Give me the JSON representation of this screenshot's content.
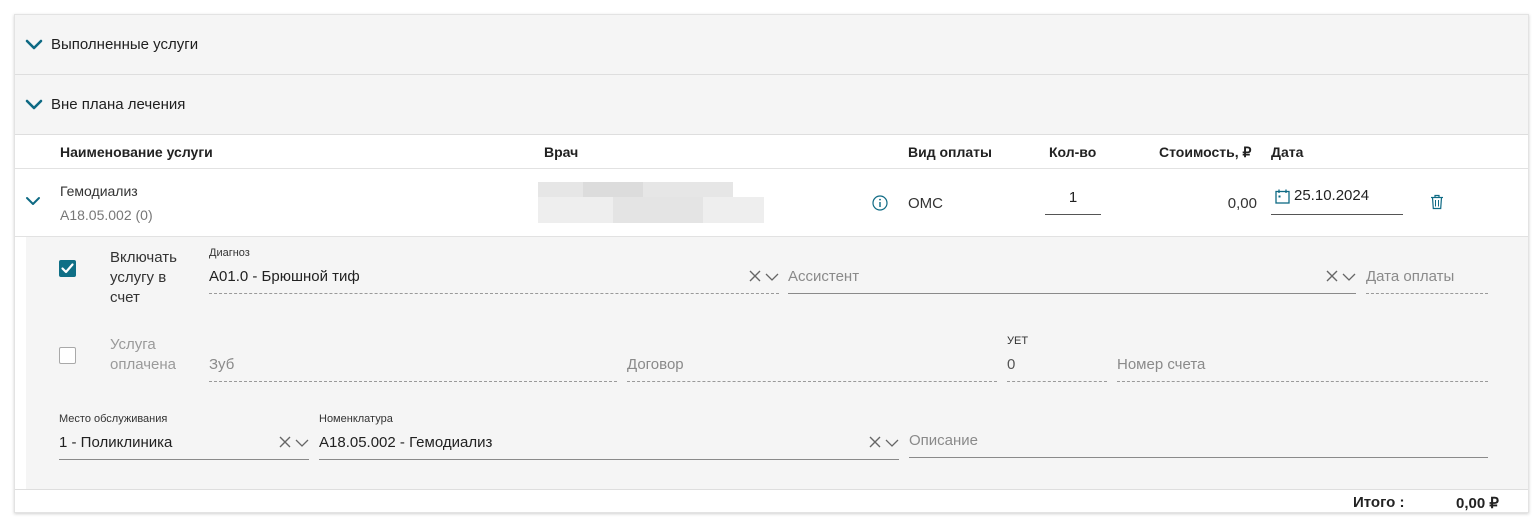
{
  "sections": {
    "done_label": "Выполненные услуги",
    "off_plan_label": "Вне плана лечения"
  },
  "table": {
    "headers": {
      "service": "Наименование услуги",
      "doctor": "Врач",
      "payment_type": "Вид оплаты",
      "qty": "Кол-во",
      "cost": "Стоимость, ₽",
      "date": "Дата"
    },
    "row": {
      "service_name": "Гемодиализ",
      "service_code": "A18.05.002 (0)",
      "payment_type": "ОМС",
      "qty": "1",
      "cost": "0,00",
      "date": "25.10.2024"
    }
  },
  "details": {
    "include_label": "Включать услугу в счет",
    "include_checked": true,
    "diagnosis": {
      "label": "Диагноз",
      "value": "A01.0 - Брюшной тиф"
    },
    "assistant": {
      "placeholder": "Ассистент"
    },
    "pay_date": {
      "placeholder": "Дата оплаты"
    },
    "paid_label": "Услуга оплачена",
    "paid_checked": false,
    "tooth": {
      "placeholder": "Зуб"
    },
    "contract": {
      "placeholder": "Договор"
    },
    "uet": {
      "label": "УЕТ",
      "value": "0"
    },
    "invoice": {
      "placeholder": "Номер счета"
    },
    "place": {
      "label": "Место обслуживания",
      "value": "1 - Поликлиника"
    },
    "nomenclature": {
      "label": "Номенклатура",
      "value": "A18.05.002 - Гемодиализ"
    },
    "description": {
      "placeholder": "Описание"
    }
  },
  "footer": {
    "total_label": "Итого :",
    "total_value": "0,00 ₽"
  },
  "colors": {
    "accent": "#0e7490",
    "checkbox": "#0f6f86"
  }
}
